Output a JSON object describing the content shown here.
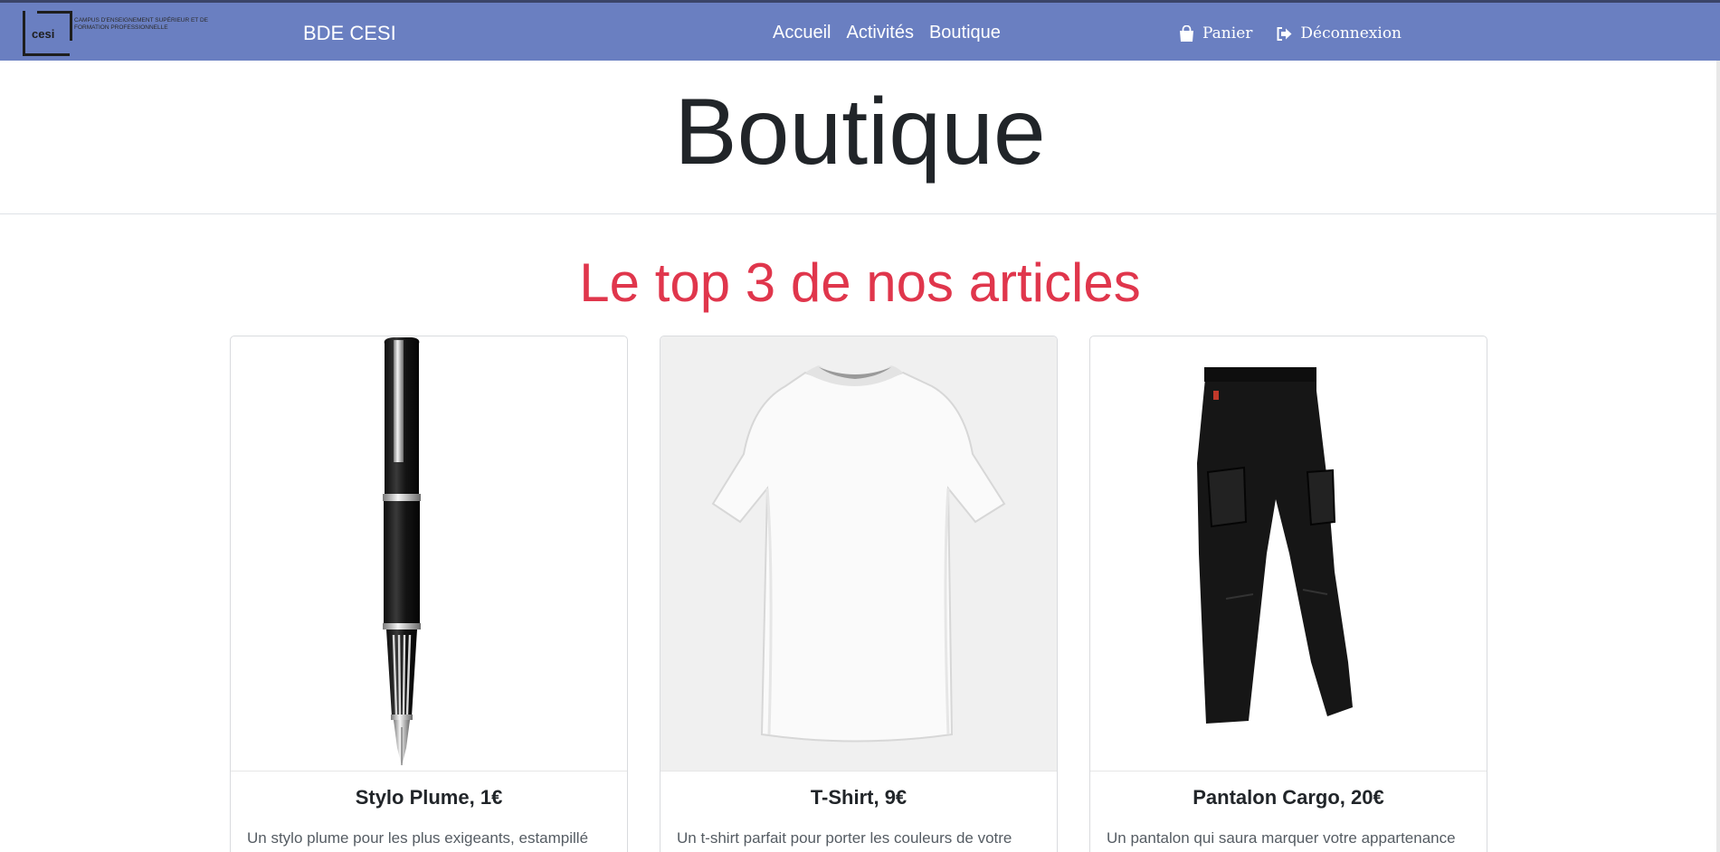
{
  "navbar": {
    "logo_word": "cesi",
    "logo_tagline": "CAMPUS D'ENSEIGNEMENT SUPÉRIEUR ET DE FORMATION PROFESSIONNELLE",
    "brand": "BDE CESI",
    "links": [
      "Accueil",
      "Activités",
      "Boutique"
    ],
    "cart_label": "Panier",
    "logout_label": "Déconnexion",
    "cart_icon": "shopping-bag-icon",
    "logout_icon": "sign-out-icon"
  },
  "page": {
    "title": "Boutique",
    "section_title": "Le top 3 de nos articles"
  },
  "products": [
    {
      "title": "Stylo Plume, 1€",
      "description": "Un stylo plume pour les plus exigeants, estampillé",
      "image": "fountain-pen-image"
    },
    {
      "title": "T-Shirt, 9€",
      "description": "Un t-shirt parfait pour porter les couleurs de votre",
      "image": "white-tshirt-image"
    },
    {
      "title": "Pantalon Cargo, 20€",
      "description": "Un pantalon qui saura marquer votre appartenance",
      "image": "black-cargo-pants-image"
    }
  ],
  "colors": {
    "navbar": "#6a7fc1",
    "section_title": "#e0364c",
    "text": "#212529"
  }
}
